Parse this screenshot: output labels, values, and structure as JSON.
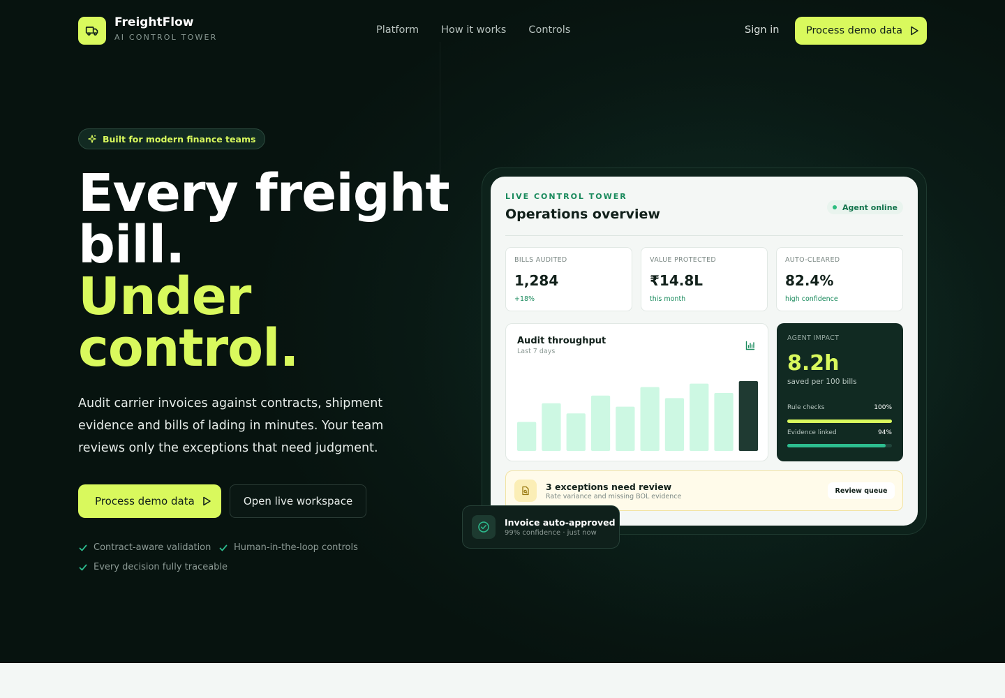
{
  "brand": {
    "name": "FreightFlow",
    "tagline": "AI CONTROL TOWER"
  },
  "nav": {
    "items": [
      "Platform",
      "How it works",
      "Controls"
    ],
    "signin": "Sign in",
    "cta": "Process demo data"
  },
  "hero": {
    "badge": "Built for modern finance teams",
    "headline_white": [
      "Every freight",
      "bill."
    ],
    "headline_accent": [
      "Under",
      "control."
    ],
    "lede": "Audit carrier invoices against contracts, shipment evidence and bills of lading in minutes. Your team reviews only the exceptions that need judgment.",
    "primary_cta": "Process demo data",
    "secondary_cta": "Open live workspace",
    "features": [
      "Contract-aware validation",
      "Human-in-the-loop controls",
      "Every decision fully traceable"
    ]
  },
  "dashboard": {
    "eyebrow": "LIVE CONTROL TOWER",
    "title": "Operations overview",
    "status": "Agent online",
    "kpis": [
      {
        "label": "BILLS AUDITED",
        "value": "1,284",
        "sub": "+18%"
      },
      {
        "label": "VALUE PROTECTED",
        "value": "₹14.8L",
        "sub": "this month"
      },
      {
        "label": "AUTO-CLEARED",
        "value": "82.4%",
        "sub": "high confidence"
      }
    ],
    "chart": {
      "title": "Audit throughput",
      "subtitle": "Last 7 days"
    },
    "impact": {
      "label": "AGENT IMPACT",
      "value": "8.2h",
      "sub": "saved per 100 bills",
      "progress": [
        {
          "label": "Rule checks",
          "pct": "100%",
          "value": 100,
          "color": "#d9f95d"
        },
        {
          "label": "Evidence linked",
          "pct": "94%",
          "value": 94,
          "color": "#2dbd8f"
        }
      ]
    },
    "alert": {
      "title": "3 exceptions need review",
      "sub": "Rate variance and missing BOL evidence",
      "button": "Review queue"
    },
    "toast": {
      "title": "Invoice auto-approved",
      "sub": "99% confidence · just now"
    }
  },
  "chart_data": {
    "type": "bar",
    "title": "Audit throughput",
    "subtitle": "Last 7 days",
    "values": [
      34,
      56,
      44,
      65,
      52,
      75,
      62,
      79,
      68,
      82
    ],
    "highlight_index": 9,
    "ylim": [
      0,
      100
    ],
    "colors": {
      "bar": "#cdf8e3",
      "highlight": "#1f3a32"
    }
  },
  "colors": {
    "accent": "#d9f95d",
    "success": "#198a5c",
    "dark": "#07130f"
  }
}
